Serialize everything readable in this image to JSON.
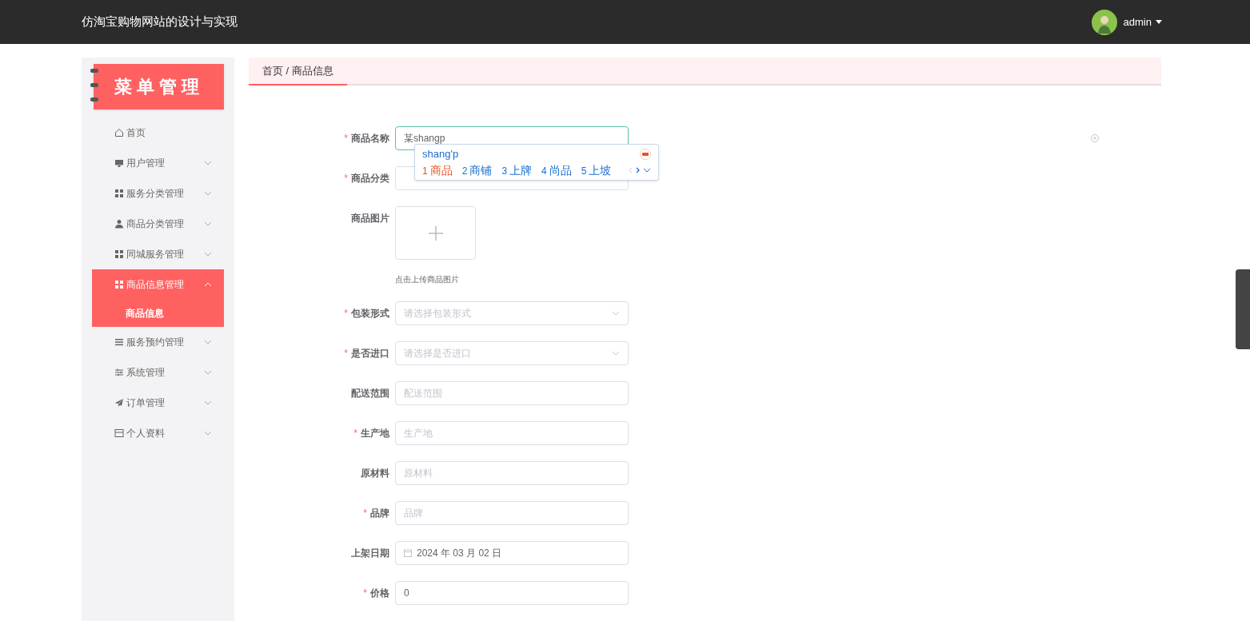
{
  "header": {
    "title": "仿淘宝购物网站的设计与实现",
    "user": "admin"
  },
  "sidebar": {
    "logo": "菜单管理",
    "items": [
      {
        "label": "首页",
        "kind": "link",
        "selected": false
      },
      {
        "label": "用户管理",
        "kind": "submenu",
        "expanded": false,
        "selected": false
      },
      {
        "label": "服务分类管理",
        "kind": "submenu",
        "expanded": false,
        "selected": false
      },
      {
        "label": "商品分类管理",
        "kind": "submenu",
        "expanded": false,
        "selected": false
      },
      {
        "label": "同城服务管理",
        "kind": "submenu",
        "expanded": false,
        "selected": false
      },
      {
        "label": "商品信息管理",
        "kind": "submenu",
        "expanded": true,
        "selected": true,
        "children": [
          {
            "label": "商品信息"
          }
        ]
      },
      {
        "label": "服务预约管理",
        "kind": "submenu",
        "expanded": false,
        "selected": false
      },
      {
        "label": "系统管理",
        "kind": "submenu",
        "expanded": false,
        "selected": false
      },
      {
        "label": "订单管理",
        "kind": "submenu",
        "expanded": false,
        "selected": false
      },
      {
        "label": "个人资料",
        "kind": "submenu",
        "expanded": false,
        "selected": false
      }
    ]
  },
  "breadcrumb": "首页 / 商品信息",
  "form": [
    {
      "kind": "text",
      "required_mark": "*",
      "label": "商品名称",
      "value": "某shangp",
      "focused": true,
      "clearable": true
    },
    {
      "kind": "select",
      "required_mark": "*",
      "label": "商品分类"
    },
    {
      "kind": "upload",
      "label": "商品图片",
      "tip": "点击上传商品图片"
    },
    {
      "kind": "select",
      "required_mark": "*",
      "label": "包装形式",
      "placeholder": "请选择包装形式",
      "arrow": true
    },
    {
      "kind": "select",
      "required_mark": "*",
      "label": "是否进口",
      "placeholder": "请选择是否进口",
      "arrow": true
    },
    {
      "kind": "text",
      "label": "配送范围",
      "placeholder": "配送范围"
    },
    {
      "kind": "text",
      "required_mark": "*",
      "label": "生产地",
      "placeholder": "生产地"
    },
    {
      "kind": "text",
      "label": "原材料",
      "placeholder": "原材料"
    },
    {
      "kind": "text",
      "required_mark": "*",
      "label": "品牌",
      "placeholder": "品牌"
    },
    {
      "kind": "date",
      "label": "上架日期",
      "value": "2024 年 03 月 02 日"
    },
    {
      "kind": "text",
      "required_mark": "*",
      "label": "价格",
      "value": "0"
    }
  ],
  "ime": {
    "composition": "shang'p",
    "candidates": [
      {
        "index": "1",
        "text": "商品",
        "selected": true
      },
      {
        "index": "2",
        "text": "商铺",
        "selected": false
      },
      {
        "index": "3",
        "text": "上牌",
        "selected": false
      },
      {
        "index": "4",
        "text": "尚品",
        "selected": false
      },
      {
        "index": "5",
        "text": "上坡",
        "selected": false
      }
    ]
  }
}
